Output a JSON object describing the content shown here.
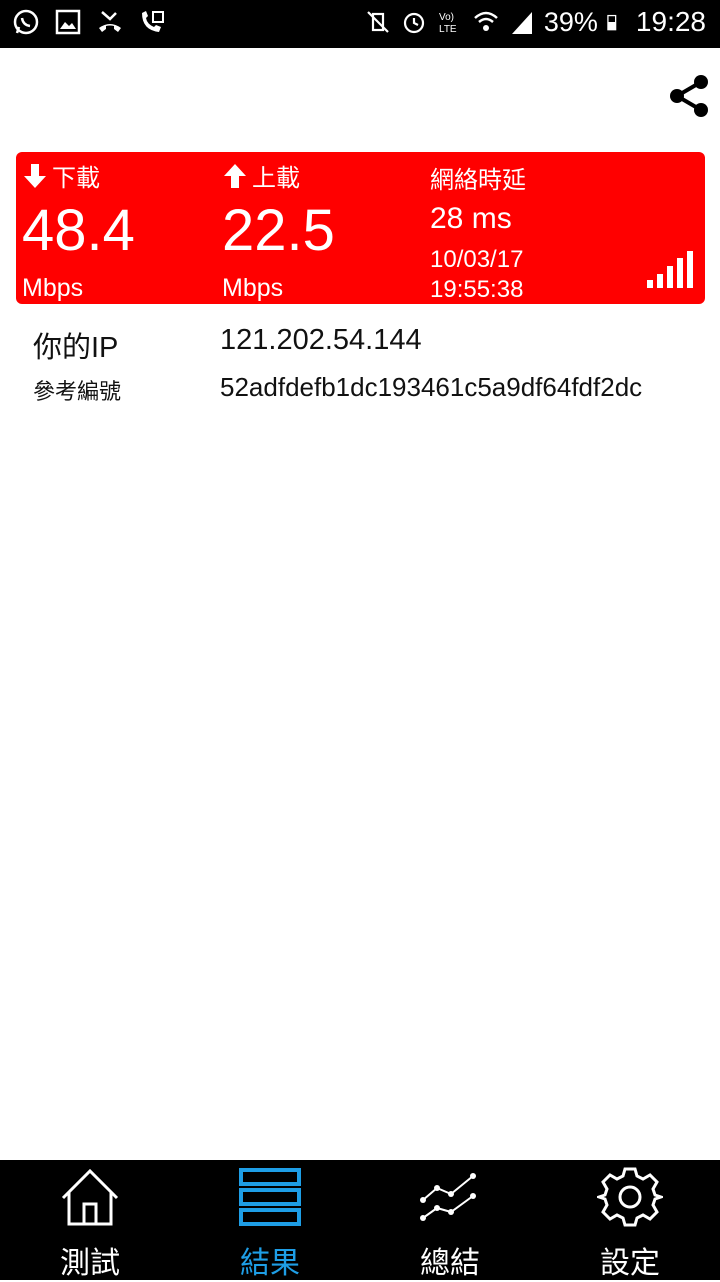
{
  "status_bar": {
    "battery": "39%",
    "time": "19:28",
    "left_icons": [
      "whatsapp-icon",
      "gallery-icon",
      "missed-call-icon",
      "call-forward-icon"
    ],
    "right_icons": [
      "mute-icon",
      "alarm-icon",
      "volte-icon",
      "wifi-icon",
      "cell-signal-icon",
      "battery-charging-icon"
    ]
  },
  "toolbar": {
    "share_icon": "share-icon"
  },
  "result": {
    "download": {
      "label": "下載",
      "value": "48.4",
      "unit": "Mbps"
    },
    "upload": {
      "label": "上載",
      "value": "22.5",
      "unit": "Mbps"
    },
    "latency": {
      "label": "網絡時延",
      "value": "28 ms",
      "date": "10/03/17",
      "time": "19:55:38"
    },
    "signal_icon": "signal-bars-icon",
    "card_color": "#ff0000"
  },
  "info": {
    "ip_label": "你的IP",
    "ip_value": "121.202.54.144",
    "ref_label": "參考編號",
    "ref_value": "52adfdefb1dc193461c5a9df64fdf2dc"
  },
  "nav": {
    "items": [
      {
        "label": "測試",
        "icon": "home-icon",
        "active": false
      },
      {
        "label": "結果",
        "icon": "list-icon",
        "active": true
      },
      {
        "label": "總結",
        "icon": "chart-line-icon",
        "active": false
      },
      {
        "label": "設定",
        "icon": "gear-icon",
        "active": false
      }
    ],
    "active_color": "#1e9ee6"
  }
}
